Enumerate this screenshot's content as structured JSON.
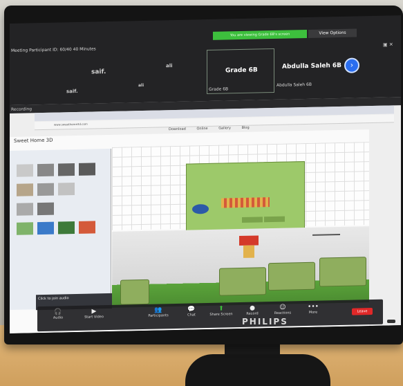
{
  "zoom": {
    "recording_banner": "You are viewing Grade 6B's screen",
    "view_options": "View Options",
    "meeting_title": "Meeting Participant ID: 60/40  40 Minutes",
    "participants": [
      {
        "name_top": "saif.",
        "name_bottom": "saif."
      },
      {
        "name_top": "ali",
        "name_bottom": "ali"
      }
    ],
    "selected_tile": {
      "title": "Grade 6B",
      "name": "Grade 6B"
    },
    "next_tile": {
      "title": "Abdulla Saleh 6B",
      "name": "Abdulla Saleh 6B"
    },
    "controls": {
      "audio": "Audio",
      "video": "Start Video",
      "participants": "Participants",
      "chat": "Chat",
      "share": "Share Screen",
      "record": "Record",
      "reactions": "Reactions",
      "more": "More",
      "leave": "Leave"
    }
  },
  "shared_screen": {
    "recording_label": "Recording",
    "url": "www.sweethome3d.com",
    "site_nav": [
      "Download",
      "Online",
      "Gallery",
      "Blog"
    ],
    "app_title": "Sweet Home 3D",
    "tooltip": "Click to join audio"
  },
  "monitor": {
    "brand": "PHILIPS"
  },
  "colors": {
    "banner_green": "#3dbf3d",
    "zoom_dark": "#232325",
    "accent_blue": "#2a6ef0",
    "leave_red": "#e02828",
    "plan_green": "#9dc96a"
  }
}
